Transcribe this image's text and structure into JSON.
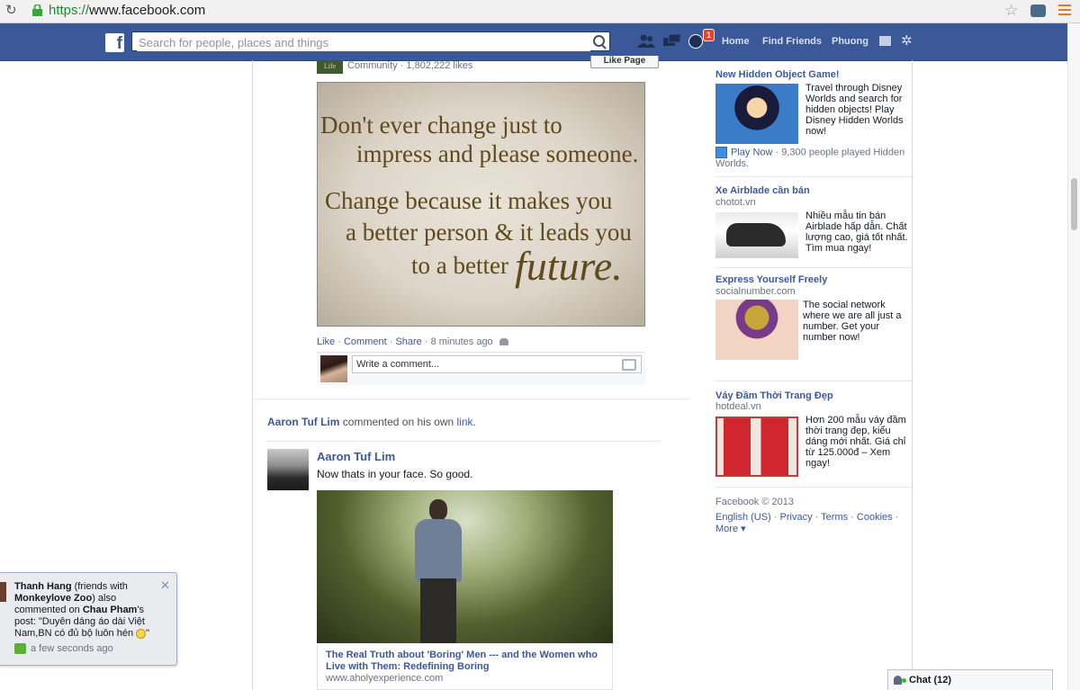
{
  "browser": {
    "url_scheme": "https://",
    "url_host": "www.facebook.com"
  },
  "nav": {
    "search_placeholder": "Search for people, places and things",
    "notification_count": "1",
    "home": "Home",
    "find_friends": "Find Friends",
    "user": "Phuong"
  },
  "post1": {
    "page_thumb_text": "Life",
    "meta": "Community · 1,802,222 likes",
    "like_page": "Like Page",
    "quote_lines": [
      "Don't ever change just to",
      "impress and please someone.",
      "Change because it makes you",
      "a better person & it leads you",
      "to a better",
      "future."
    ],
    "actions": {
      "like": "Like",
      "comment": "Comment",
      "share": "Share",
      "time": "8 minutes ago"
    },
    "comment_placeholder": "Write a comment..."
  },
  "story2": {
    "actor": "Aaron Tuf Lim",
    "verb": "commented on his own",
    "object": "link",
    "author": "Aaron Tuf Lim",
    "text": "Now thats in your face. So good.",
    "link_title": "The Real Truth about 'Boring' Men --- and the Women who Live with Them: Redefining Boring",
    "link_domain": "www.aholyexperience.com"
  },
  "ads": [
    {
      "title": "New Hidden Object Game!",
      "body": "Travel through Disney Worlds and search for hidden objects! Play Disney Hidden Worlds now!",
      "action": "Play Now",
      "social": "9,300 people played Hidden Worlds."
    },
    {
      "title": "Xe Airblade cần bán",
      "domain": "chotot.vn",
      "body": "Nhiều mẫu tin bán Airblade hấp dẫn. Chất lượng cao, giá tốt nhất. Tìm mua ngay!"
    },
    {
      "title": "Express Yourself Freely",
      "domain": "socialnumber.com",
      "body": "The social network where we are all just a number. Get your number now!"
    },
    {
      "title": "Váy Đầm Thời Trang Đẹp",
      "domain": "hotdeal.vn",
      "body": "Hơn 200 mẫu váy đầm thời trang đẹp, kiểu dáng mới nhất. Giá chỉ từ 125.000đ – Xem ngay!"
    }
  ],
  "footer": {
    "copyright": "Facebook © 2013",
    "links": [
      "English (US)",
      "Privacy",
      "Terms",
      "Cookies",
      "More ▾"
    ]
  },
  "toast": {
    "actor": "Thanh Hang",
    "friends_prefix": "(friends with",
    "friend": "Monkeylove Zoo",
    "mid": ") also commented on",
    "owner": "Chau Pham",
    "post_prefix": "'s post: \"Duyên dáng áo dài Việt Nam,BN có đủ bộ luôn hén",
    "post_suffix": "\"",
    "time": "a few seconds ago"
  },
  "chat": {
    "label": "Chat (12)"
  }
}
